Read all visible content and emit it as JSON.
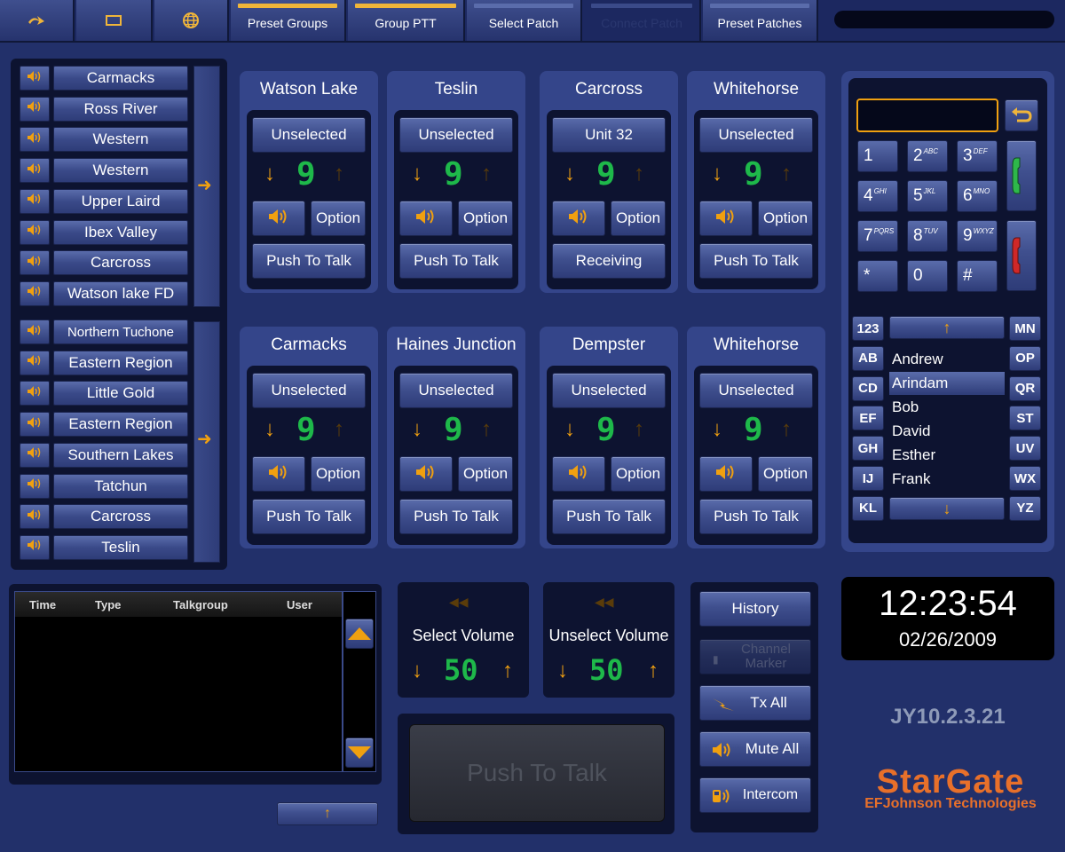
{
  "toolbar": {
    "icons": [
      "redo-arrow-icon",
      "window-icon",
      "globe-icon"
    ],
    "tabs": [
      {
        "label": "Preset Groups",
        "bar_color": "#f0b53a"
      },
      {
        "label": "Group PTT",
        "bar_color": "#f0b53a"
      },
      {
        "label": "Select Patch",
        "bar_color": "#5a6cab"
      },
      {
        "label": "Connect Patch",
        "bar_color": "#3a4a89"
      },
      {
        "label": "Preset Patches",
        "bar_color": "#5a6cab"
      }
    ]
  },
  "channel_list": {
    "group1": [
      "Carmacks",
      "Ross River",
      "Western",
      "Western",
      "Upper Laird",
      "Ibex Valley",
      "Carcross",
      "Watson lake FD"
    ],
    "group2": [
      "Northern Tuchone",
      "Eastern Region",
      "Little Gold",
      "Eastern Region",
      "Southern Lakes",
      "Tatchun",
      "Carcross",
      "Teslin"
    ]
  },
  "modules": [
    {
      "title": "Watson Lake",
      "select": "Unselected",
      "digit": "9",
      "option": "Option",
      "ptt": "Push To Talk"
    },
    {
      "title": "Teslin",
      "select": "Unselected",
      "digit": "9",
      "option": "Option",
      "ptt": "Push To Talk"
    },
    {
      "title": "Carcross",
      "select": "Unit 32",
      "digit": "9",
      "option": "Option",
      "ptt": "Receiving"
    },
    {
      "title": "Whitehorse",
      "select": "Unselected",
      "digit": "9",
      "option": "Option",
      "ptt": "Push To Talk"
    },
    {
      "title": "Carmacks",
      "select": "Unselected",
      "digit": "9",
      "option": "Option",
      "ptt": "Push To Talk"
    },
    {
      "title": "Haines Junction",
      "select": "Unselected",
      "digit": "9",
      "option": "Option",
      "ptt": "Push To Talk"
    },
    {
      "title": "Dempster",
      "select": "Unselected",
      "digit": "9",
      "option": "Option",
      "ptt": "Push To Talk"
    },
    {
      "title": "Whitehorse",
      "select": "Unselected",
      "digit": "9",
      "option": "Option",
      "ptt": "Push To Talk"
    }
  ],
  "phone": {
    "dial_value": "",
    "keys": [
      {
        "d": "1",
        "l": ""
      },
      {
        "d": "2",
        "l": "ABC"
      },
      {
        "d": "3",
        "l": "DEF"
      },
      {
        "d": "4",
        "l": "GHI"
      },
      {
        "d": "5",
        "l": "JKL"
      },
      {
        "d": "6",
        "l": "MNO"
      },
      {
        "d": "7",
        "l": "PQRS"
      },
      {
        "d": "8",
        "l": "TUV"
      },
      {
        "d": "9",
        "l": "WXYZ"
      },
      {
        "d": "*",
        "l": ""
      },
      {
        "d": "0",
        "l": ""
      },
      {
        "d": "#",
        "l": ""
      }
    ],
    "index_left": [
      "123",
      "AB",
      "CD",
      "EF",
      "GH",
      "IJ",
      "KL"
    ],
    "index_right": [
      "MN",
      "OP",
      "QR",
      "ST",
      "UV",
      "WX",
      "YZ"
    ],
    "contacts": [
      "Andrew",
      "Arindam",
      "Bob",
      "David",
      "Esther",
      "Frank"
    ],
    "selected_contact": "Arindam",
    "call_color": "#2eb84a",
    "hangup_color": "#d02828"
  },
  "log": {
    "columns": [
      "Time",
      "Type",
      "Talkgroup",
      "User"
    ]
  },
  "volumes": {
    "select_label": "Select Volume",
    "select_value": "50",
    "unselect_label": "Unselect Volume",
    "unselect_value": "50"
  },
  "ptt_main": "Push To Talk",
  "actions": {
    "history": "History",
    "channel_marker": "Channel Marker",
    "tx_all": "Tx All",
    "mute_all": "Mute All",
    "intercom": "Intercom"
  },
  "clock": {
    "time": "12:23:54",
    "date": "02/26/2009"
  },
  "version": "JY10.2.3.21",
  "brand": {
    "name": "StarGate",
    "company": "EFJohnson Technologies",
    "color": "#e8702a"
  }
}
